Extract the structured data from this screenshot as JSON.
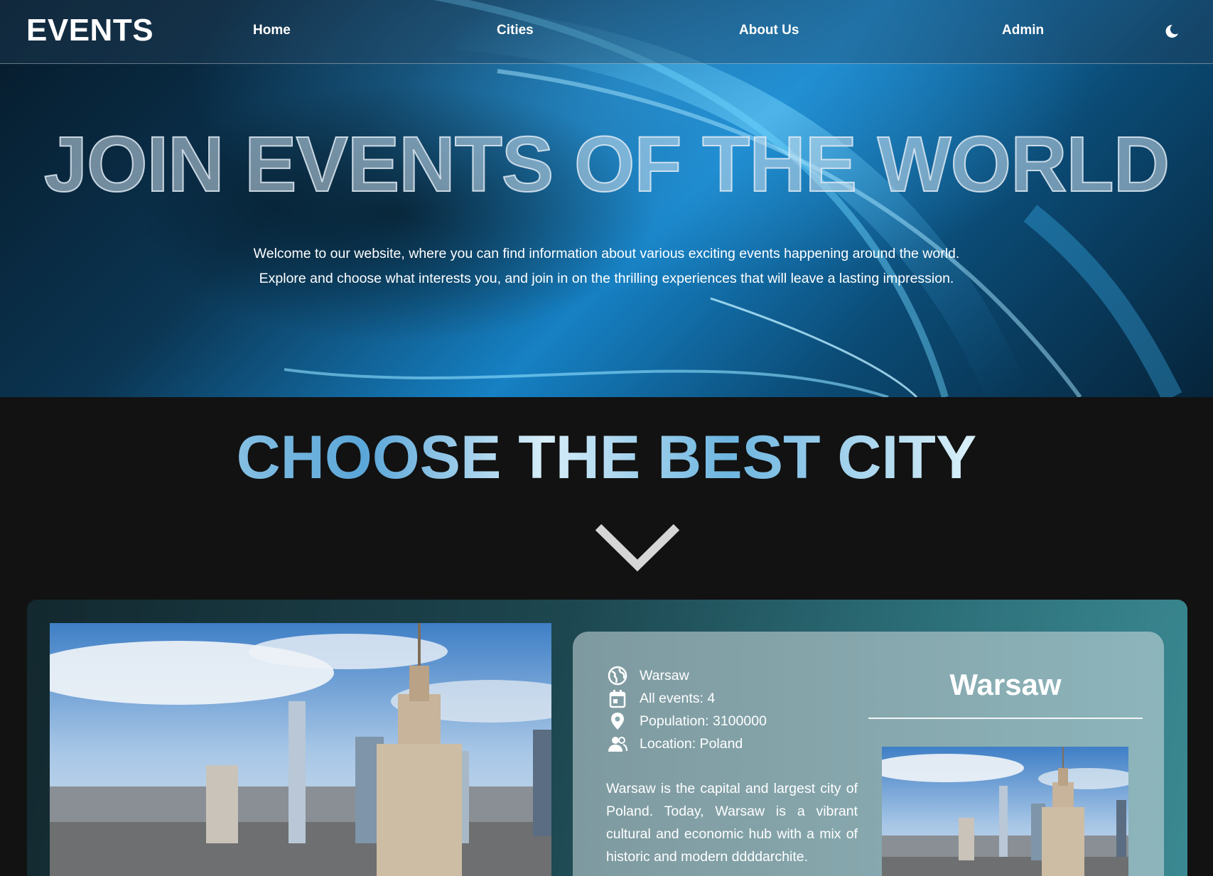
{
  "navbar": {
    "brand": "EVENTS",
    "links": [
      {
        "label": "Home"
      },
      {
        "label": "Cities"
      },
      {
        "label": "About Us"
      },
      {
        "label": "Admin"
      }
    ],
    "theme_icon": "moon-icon"
  },
  "hero": {
    "title": "JOIN EVENTS OF THE WORLD",
    "text_line1": "Welcome to our website, where you can find information about various exciting events happening around the world.",
    "text_line2": "Explore and choose what interests you, and join in on the thrilling experiences that will leave a lasting impression."
  },
  "section": {
    "title": "CHOOSE THE BEST CITY",
    "scroll_icon": "chevron-down-icon"
  },
  "city": {
    "name": "Warsaw",
    "info": [
      {
        "icon": "globe-icon",
        "text": "Warsaw"
      },
      {
        "icon": "calendar-icon",
        "text": "All events: 4"
      },
      {
        "icon": "location-pin-icon",
        "text": "Population: 3100000"
      },
      {
        "icon": "people-icon",
        "text": "Location: Poland"
      }
    ],
    "description": "Warsaw is the capital and largest city of Poland. Today, Warsaw is a vibrant cultural and economic hub with a mix of historic and modern ddddarchite."
  },
  "colors": {
    "hero_blue": "#1681c4",
    "page_background": "#121212",
    "card_teal": "#2c6f79",
    "panel_grey": "#86a7ad"
  }
}
